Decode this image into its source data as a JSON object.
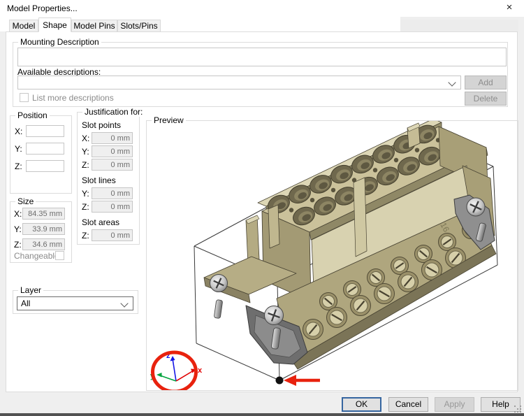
{
  "window": {
    "title": "Model Properties...",
    "close_glyph": "×"
  },
  "tabs": [
    {
      "label": "Model"
    },
    {
      "label": "Shape"
    },
    {
      "label": "Model Pins"
    },
    {
      "label": "Slots/Pins"
    }
  ],
  "active_tab": "Shape",
  "mounting": {
    "group_label": "Mounting Description",
    "description_value": "",
    "available_label": "Available descriptions:",
    "available_value": "",
    "add_label": "Add",
    "delete_label": "Delete",
    "list_more_label": "List more descriptions",
    "list_more_checked": false
  },
  "position": {
    "group_label": "Position",
    "fields": [
      {
        "label": "X:",
        "value": ""
      },
      {
        "label": "Y:",
        "value": ""
      },
      {
        "label": "Z:",
        "value": ""
      }
    ]
  },
  "justification": {
    "group_label": "Justification for:",
    "sections": [
      {
        "title": "Slot points",
        "fields": [
          {
            "label": "X:",
            "value": "0 mm"
          },
          {
            "label": "Y:",
            "value": "0 mm"
          },
          {
            "label": "Z:",
            "value": "0 mm"
          }
        ]
      },
      {
        "title": "Slot lines",
        "fields": [
          {
            "label": "Y:",
            "value": "0 mm"
          },
          {
            "label": "Z:",
            "value": "0 mm"
          }
        ]
      },
      {
        "title": "Slot areas",
        "fields": [
          {
            "label": "Z:",
            "value": "0 mm"
          }
        ]
      }
    ]
  },
  "size": {
    "group_label": "Size",
    "fields": [
      {
        "label": "X:",
        "value": "84.35 mm"
      },
      {
        "label": "Y:",
        "value": "33.9 mm"
      },
      {
        "label": "Z:",
        "value": "34.6 mm"
      }
    ],
    "changeable_label": "Changeable:",
    "changeable_checked": false
  },
  "layer": {
    "group_label": "Layer",
    "value": "All"
  },
  "preview": {
    "group_label": "Preview",
    "model_marking": "16",
    "axis": {
      "x": "x",
      "y": "y",
      "z": "z"
    }
  },
  "buttons": {
    "ok": "OK",
    "cancel": "Cancel",
    "apply": "Apply",
    "help": "Help"
  },
  "colors": {
    "highlight_red": "#e8220e",
    "axis_x": "#e00000",
    "axis_y": "#00a33e",
    "axis_z": "#1515e6",
    "model_body": "#b3aa82",
    "default_button_border": "#3666a0"
  }
}
